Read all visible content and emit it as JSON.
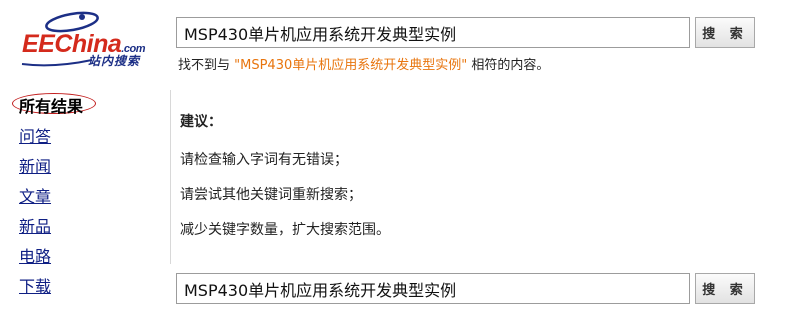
{
  "logo": {
    "main": "EEChina",
    "suffix": ".com",
    "sub": "站内搜索"
  },
  "search": {
    "query": "MSP430单片机应用系统开发典型实例",
    "button_label": "搜 索"
  },
  "notice": {
    "prefix": "找不到与 ",
    "query": "\"MSP430单片机应用系统开发典型实例\"",
    "suffix": " 相符的内容。"
  },
  "sidebar": {
    "active": "所有结果",
    "items": [
      "问答",
      "新闻",
      "文章",
      "新品",
      "电路",
      "下载"
    ]
  },
  "advice": {
    "title": "建议：",
    "items": [
      "请检查输入字词有无错误；",
      "请尝试其他关键词重新搜索；",
      "减少关键字数量，扩大搜索范围。"
    ]
  },
  "colors": {
    "logo_red": "#d42a1c",
    "logo_blue": "#1c2f86",
    "query_orange": "#e8750e",
    "link_blue": "#0f1f84",
    "active_ring": "#c21e1e"
  },
  "icons": [
    "eechina-logo-icon"
  ]
}
